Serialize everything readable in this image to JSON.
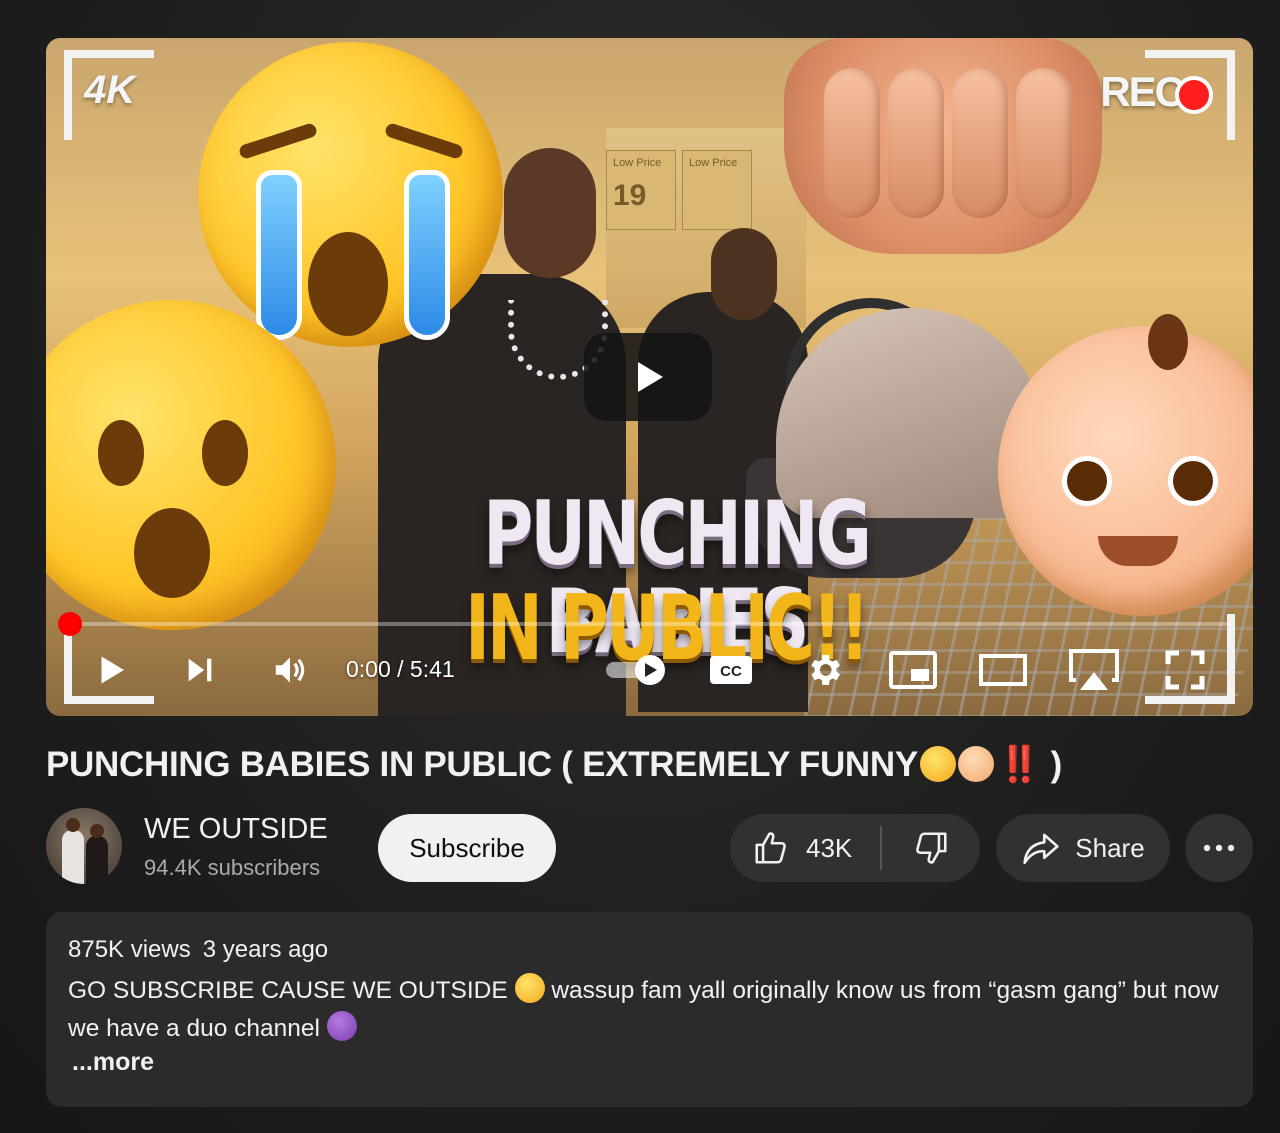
{
  "player": {
    "badge_4k": "4K",
    "badge_rec": "REC",
    "thumbnail_title_line1": "PUNCHING BABIES",
    "thumbnail_title_line2": "IN PUBLIC!!",
    "price_tag_1": "19",
    "price_tag_1_label": "Low Price",
    "price_tag_2_label": "Low Price",
    "time_display": "0:00 / 5:41",
    "progress": 0,
    "icons": [
      "play-icon",
      "next-icon",
      "volume-icon",
      "autoplay-toggle-icon",
      "captions-icon",
      "settings-icon",
      "miniplayer-icon",
      "theater-icon",
      "airplay-icon",
      "fullscreen-icon"
    ]
  },
  "video": {
    "title": "PUNCHING BABIES IN PUBLIC ( EXTREMELY FUNNY",
    "title_suffix_marks": "‼️",
    "title_close": " )"
  },
  "channel": {
    "name": "WE OUTSIDE",
    "subscribers": "94.4K subscribers",
    "subscribe_label": "Subscribe"
  },
  "actions": {
    "like_count": "43K",
    "share_label": "Share"
  },
  "description": {
    "views": "875K views",
    "age": "3 years ago",
    "text_part1": "GO SUBSCRIBE CAUSE WE OUTSIDE ",
    "text_part2": " wassup fam yall originally know us from “gasm gang” but now we have a duo channel ",
    "more_label": "...more"
  },
  "colors": {
    "accent_red": "#ff0000",
    "pill_bg": "#313131",
    "desc_bg": "#2b2b2b"
  }
}
